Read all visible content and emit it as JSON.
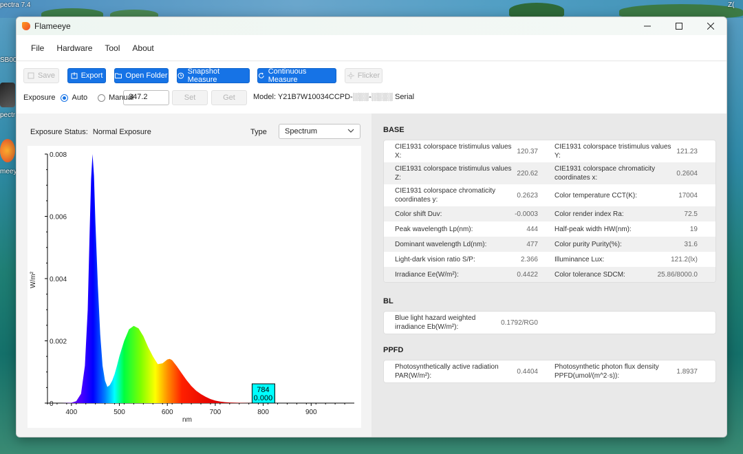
{
  "desktop": {
    "labels": [
      "pectra 7.4",
      "SB00",
      "pectr",
      "meeye"
    ]
  },
  "window": {
    "title": "Flameeye",
    "controls": [
      "minimize",
      "maximize",
      "close"
    ]
  },
  "menu": [
    "File",
    "Hardware",
    "Tool",
    "About"
  ],
  "toolbar": {
    "save_label": "Save",
    "export_label": "Export",
    "open_folder_label": "Open Folder",
    "snapshot_label": "Snapshot Measure",
    "continuous_label": "Continuous Measure",
    "flicker_label": "Flicker",
    "exposure_label": "Exposure",
    "auto_label": "Auto",
    "manual_label": "Manual",
    "exposure_value": "347.2",
    "set_label": "Set",
    "get_label": "Get",
    "model_text": "Model: Y21B7W10034CCPD-░░░-░░░░ Serial",
    "mode_selected": "Auto"
  },
  "left": {
    "exposure_status_label": "Exposure Status:",
    "exposure_status_value": "Normal Exposure",
    "type_label": "Type",
    "type_selected": "Spectrum"
  },
  "chart_data": {
    "type": "area",
    "title": "",
    "xlabel": "nm",
    "ylabel": "W/m²",
    "xlim": [
      350,
      990
    ],
    "ylim": [
      0,
      0.008
    ],
    "xticks": [
      400,
      500,
      600,
      700,
      800,
      900
    ],
    "yticks": [
      "0.008",
      "0.006",
      "0.004",
      "0.002",
      "0"
    ],
    "series": [
      {
        "x": [
          380,
          400,
          410,
          420,
          428,
          434,
          438,
          441,
          444,
          447,
          450,
          455,
          460,
          465,
          470,
          475,
          480,
          485,
          490,
          495,
          500,
          510,
          520,
          530,
          540,
          550,
          560,
          570,
          580,
          590,
          600,
          605,
          610,
          620,
          630,
          640,
          650,
          660,
          670,
          680,
          690,
          700,
          710,
          720,
          730,
          750,
          780
        ],
        "y": [
          0,
          1e-05,
          6e-05,
          0.0003,
          0.0012,
          0.003,
          0.0055,
          0.0072,
          0.008,
          0.0073,
          0.0058,
          0.0038,
          0.0022,
          0.0012,
          0.00072,
          0.00052,
          0.00058,
          0.00072,
          0.00093,
          0.0012,
          0.0015,
          0.002,
          0.00237,
          0.00248,
          0.0024,
          0.00215,
          0.0018,
          0.0015,
          0.00125,
          0.00128,
          0.0014,
          0.00142,
          0.00138,
          0.00118,
          0.00096,
          0.00074,
          0.00055,
          0.0004,
          0.00029,
          0.0002,
          0.00013,
          8e-05,
          5e-05,
          3e-05,
          2e-05,
          1e-05,
          0
        ]
      }
    ],
    "cursor_label": [
      "784",
      "0.000"
    ],
    "cursor_x": 784
  },
  "base": {
    "title": "BASE",
    "rows": [
      [
        {
          "label": "CIE1931 colorspace tristimulus values X:",
          "value": "120.37"
        },
        {
          "label": "CIE1931 colorspace tristimulus values Y:",
          "value": "121.23"
        }
      ],
      [
        {
          "label": "CIE1931 colorspace tristimulus values Z:",
          "value": "220.62"
        },
        {
          "label": "CIE1931 colorspace chromaticity coordinates x:",
          "value": "0.2604"
        }
      ],
      [
        {
          "label": "CIE1931 colorspace chromaticity coordinates y:",
          "value": "0.2623"
        },
        {
          "label": "Color temperature CCT(K):",
          "value": "17004"
        }
      ],
      [
        {
          "label": "Color shift Duv:",
          "value": "-0.0003"
        },
        {
          "label": "Color render index Ra:",
          "value": "72.5"
        }
      ],
      [
        {
          "label": "Peak wavelength Lp(nm):",
          "value": "444"
        },
        {
          "label": "Half-peak width HW(nm):",
          "value": "19"
        }
      ],
      [
        {
          "label": "Dominant wavelength Ld(nm):",
          "value": "477"
        },
        {
          "label": "Color purity Purity(%):",
          "value": "31.6"
        }
      ],
      [
        {
          "label": "Light-dark vision ratio S/P:",
          "value": "2.366"
        },
        {
          "label": "Illuminance Lux:",
          "value": "121.2(lx)"
        }
      ],
      [
        {
          "label": "Irradiance Ee(W/m²):",
          "value": "0.4422"
        },
        {
          "label": "Color tolerance SDCM:",
          "value": "25.86/8000.0"
        }
      ]
    ]
  },
  "bl": {
    "title": "BL",
    "rows": [
      [
        {
          "label": "Blue light hazard weighted irradiance Eb(W/m²):",
          "value": "0.1792/RG0"
        },
        {
          "label": "",
          "value": ""
        }
      ]
    ]
  },
  "ppfd": {
    "title": "PPFD",
    "rows": [
      [
        {
          "label": "Photosynthetically active radiation PAR(W/m²):",
          "value": "0.4404"
        },
        {
          "label": "Photosynthetic photon flux density PPFD(umol/(m^2·s)):",
          "value": "1.8937"
        }
      ]
    ]
  },
  "colors": {
    "accent": "#1673e6",
    "cursor_box": "#00ffff"
  }
}
